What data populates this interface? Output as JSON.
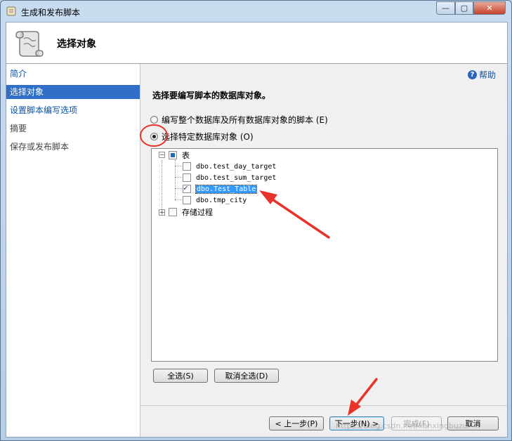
{
  "window": {
    "title": "生成和发布脚本",
    "controls": {
      "minimize": "—",
      "maximize": "▢",
      "close": "✕"
    }
  },
  "header": {
    "title": "选择对象",
    "icon": "script-scroll-icon"
  },
  "nav": {
    "items": [
      {
        "label": "简介",
        "state": "link"
      },
      {
        "label": "选择对象",
        "state": "selected"
      },
      {
        "label": "设置脚本编写选项",
        "state": "link"
      },
      {
        "label": "摘要",
        "state": "disabled"
      },
      {
        "label": "保存或发布脚本",
        "state": "disabled"
      }
    ]
  },
  "help": {
    "label": "帮助",
    "icon": "help-icon"
  },
  "main": {
    "section_title": "选择要编写脚本的数据库对象。",
    "options": [
      {
        "label": "编写整个数据库及所有数据库对象的脚本 (E)",
        "selected": false
      },
      {
        "label": "选择特定数据库对象 (O)",
        "selected": true
      }
    ],
    "tree": {
      "root_tables": {
        "label": "表",
        "expander": "−",
        "check": "partial"
      },
      "tables": [
        {
          "label": "dbo.test_day_target",
          "checked": false
        },
        {
          "label": "dbo.test_sum_target",
          "checked": false
        },
        {
          "label": "dbo.Test_Table",
          "checked": true,
          "selected": true
        },
        {
          "label": "dbo.tmp_city",
          "checked": false
        }
      ],
      "root_procs": {
        "label": "存储过程",
        "expander": "+",
        "check": "none"
      }
    },
    "select_all": "全选(S)",
    "deselect_all": "取消全选(D)"
  },
  "footer": {
    "prev": "< 上一步(P)",
    "next": "下一步(N) >",
    "finish": "完成(F)",
    "cancel": "取消"
  },
  "watermark": "https://blog.csdn.net/lianxingbuzu",
  "colors": {
    "annotation": "#e8322a",
    "selection": "#3399ff",
    "nav_selected": "#2f6fc7",
    "link": "#0b53a8"
  }
}
